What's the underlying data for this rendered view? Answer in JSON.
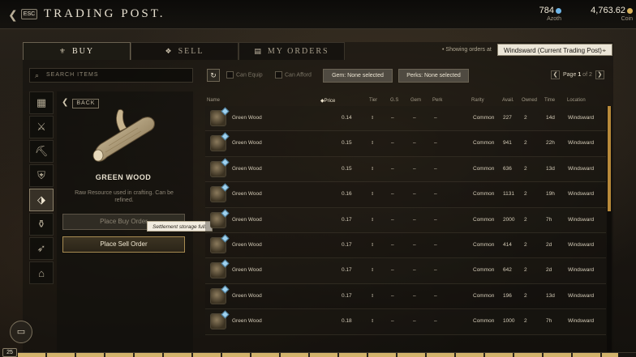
{
  "header": {
    "title": "TRADING POST.",
    "esc_label": "ESC",
    "azoth_value": "784",
    "azoth_label": "Azoth",
    "coin_value": "4,763.62",
    "coin_label": "Coin",
    "azoth_color": "#6fb6e8",
    "coin_color": "#d8b25a"
  },
  "tabs": [
    {
      "label": "BUY",
      "icon": "buy-icon",
      "active": true
    },
    {
      "label": "SELL",
      "icon": "sell-icon",
      "active": false
    },
    {
      "label": "MY ORDERS",
      "icon": "orders-icon",
      "active": false
    }
  ],
  "showing_label": "Showing orders at",
  "location": "Windsward (Current Trading Post)",
  "search": {
    "placeholder": "SEARCH ITEMS"
  },
  "categories": [
    {
      "icon": "grid-icon",
      "active": false
    },
    {
      "icon": "crossed-swords-icon",
      "active": false
    },
    {
      "icon": "pickaxe-icon",
      "active": false
    },
    {
      "icon": "armor-icon",
      "active": false
    },
    {
      "icon": "raw-resource-icon",
      "active": true
    },
    {
      "icon": "consumable-icon",
      "active": false
    },
    {
      "icon": "ammo-icon",
      "active": false
    },
    {
      "icon": "furniture-icon",
      "active": false
    }
  ],
  "detail": {
    "back_label": "BACK",
    "item_name": "GREEN WOOD",
    "item_desc": "Raw Resource used in crafting. Can be refined.",
    "buy_button": "Place Buy Order",
    "sell_button": "Place Sell Order",
    "tooltip": "Settlement storage full."
  },
  "filters": {
    "can_equip": "Can Equip",
    "can_afford": "Can Afford",
    "gem": "Gem: None selected",
    "perks": "Perks: None selected",
    "page_label": "Page",
    "page_current": "1",
    "page_of": "of 2"
  },
  "columns": {
    "name": "Name",
    "price": "Price",
    "tier": "Tier",
    "gs": "G.S",
    "gem": "Gem",
    "perk": "Perk",
    "rarity": "Rarity",
    "avail": "Avail.",
    "owned": "Owned",
    "time": "Time",
    "location": "Location"
  },
  "rows": [
    {
      "name": "Green Wood",
      "price": "0.14",
      "tier": "I",
      "gs": "–",
      "gem": "–",
      "perk": "–",
      "rarity": "Common",
      "avail": "227",
      "owned": "2",
      "time": "14d",
      "location": "Windsward"
    },
    {
      "name": "Green Wood",
      "price": "0.15",
      "tier": "I",
      "gs": "–",
      "gem": "–",
      "perk": "–",
      "rarity": "Common",
      "avail": "941",
      "owned": "2",
      "time": "22h",
      "location": "Windsward"
    },
    {
      "name": "Green Wood",
      "price": "0.15",
      "tier": "I",
      "gs": "–",
      "gem": "–",
      "perk": "–",
      "rarity": "Common",
      "avail": "636",
      "owned": "2",
      "time": "13d",
      "location": "Windsward"
    },
    {
      "name": "Green Wood",
      "price": "0.16",
      "tier": "I",
      "gs": "–",
      "gem": "–",
      "perk": "–",
      "rarity": "Common",
      "avail": "1131",
      "owned": "2",
      "time": "19h",
      "location": "Windsward"
    },
    {
      "name": "Green Wood",
      "price": "0.17",
      "tier": "I",
      "gs": "–",
      "gem": "–",
      "perk": "–",
      "rarity": "Common",
      "avail": "2000",
      "owned": "2",
      "time": "7h",
      "location": "Windsward"
    },
    {
      "name": "Green Wood",
      "price": "0.17",
      "tier": "I",
      "gs": "–",
      "gem": "–",
      "perk": "–",
      "rarity": "Common",
      "avail": "414",
      "owned": "2",
      "time": "2d",
      "location": "Windsward"
    },
    {
      "name": "Green Wood",
      "price": "0.17",
      "tier": "I",
      "gs": "–",
      "gem": "–",
      "perk": "–",
      "rarity": "Common",
      "avail": "642",
      "owned": "2",
      "time": "2d",
      "location": "Windsward"
    },
    {
      "name": "Green Wood",
      "price": "0.17",
      "tier": "I",
      "gs": "–",
      "gem": "–",
      "perk": "–",
      "rarity": "Common",
      "avail": "196",
      "owned": "2",
      "time": "13d",
      "location": "Windsward"
    },
    {
      "name": "Green Wood",
      "price": "0.18",
      "tier": "I",
      "gs": "–",
      "gem": "–",
      "perk": "–",
      "rarity": "Common",
      "avail": "1000",
      "owned": "2",
      "time": "7h",
      "location": "Windsward"
    }
  ],
  "bottom": {
    "level": "25"
  }
}
